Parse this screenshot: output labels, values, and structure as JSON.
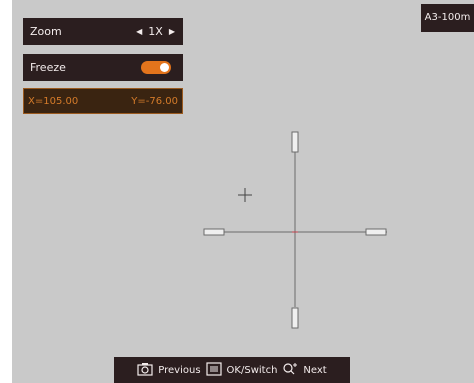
{
  "menu": {
    "zoom_label": "Zoom",
    "zoom_value": "1X",
    "freeze_label": "Freeze",
    "freeze_on": true,
    "coord_x": "X=105.00",
    "coord_y": "Y=-76.00"
  },
  "profile_badge": "A3-100m",
  "bottom_bar": {
    "previous_label": "Previous",
    "ok_switch_label": "OK/Switch",
    "next_label": "Next"
  },
  "icons": {
    "zoom_left": "triangle-left",
    "zoom_right": "triangle-right",
    "camera": "camera-icon",
    "menu": "menu-icon",
    "zoom_plus_minus": "zoom-plus-minus-icon"
  },
  "colors": {
    "screen_bg": "#c9c9c9",
    "panel_bg": "#2b1e1f",
    "accent_orange": "#e3741c",
    "coord_text": "#d47b2a",
    "reticle": "#6b6b6b",
    "reticle_center": "#c0404a"
  }
}
